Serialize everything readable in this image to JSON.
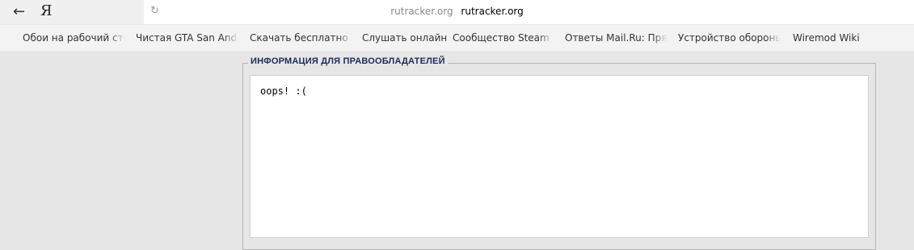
{
  "browser": {
    "back_glyph": "←",
    "logo_glyph": "Я",
    "reload_glyph": "↻",
    "url_host": "rutracker.org",
    "url_title": "rutracker.org"
  },
  "bookmarks": [
    {
      "label": "Обои на рабочий стол"
    },
    {
      "label": "Чистая GTA San Andreas"
    },
    {
      "label": "Скачать бесплатно игры"
    },
    {
      "label": "Слушать онлайн"
    },
    {
      "label": "Сообщество Steam :: "
    },
    {
      "label": "Ответы Mail.Ru: Прямой"
    },
    {
      "label": "Устройство обороны"
    },
    {
      "label": "Wiremod Wiki"
    }
  ],
  "panel": {
    "legend": "ИНФОРМАЦИЯ ДЛЯ ПРАВООБЛАДАТЕЛЕЙ",
    "message": "oops! :("
  }
}
